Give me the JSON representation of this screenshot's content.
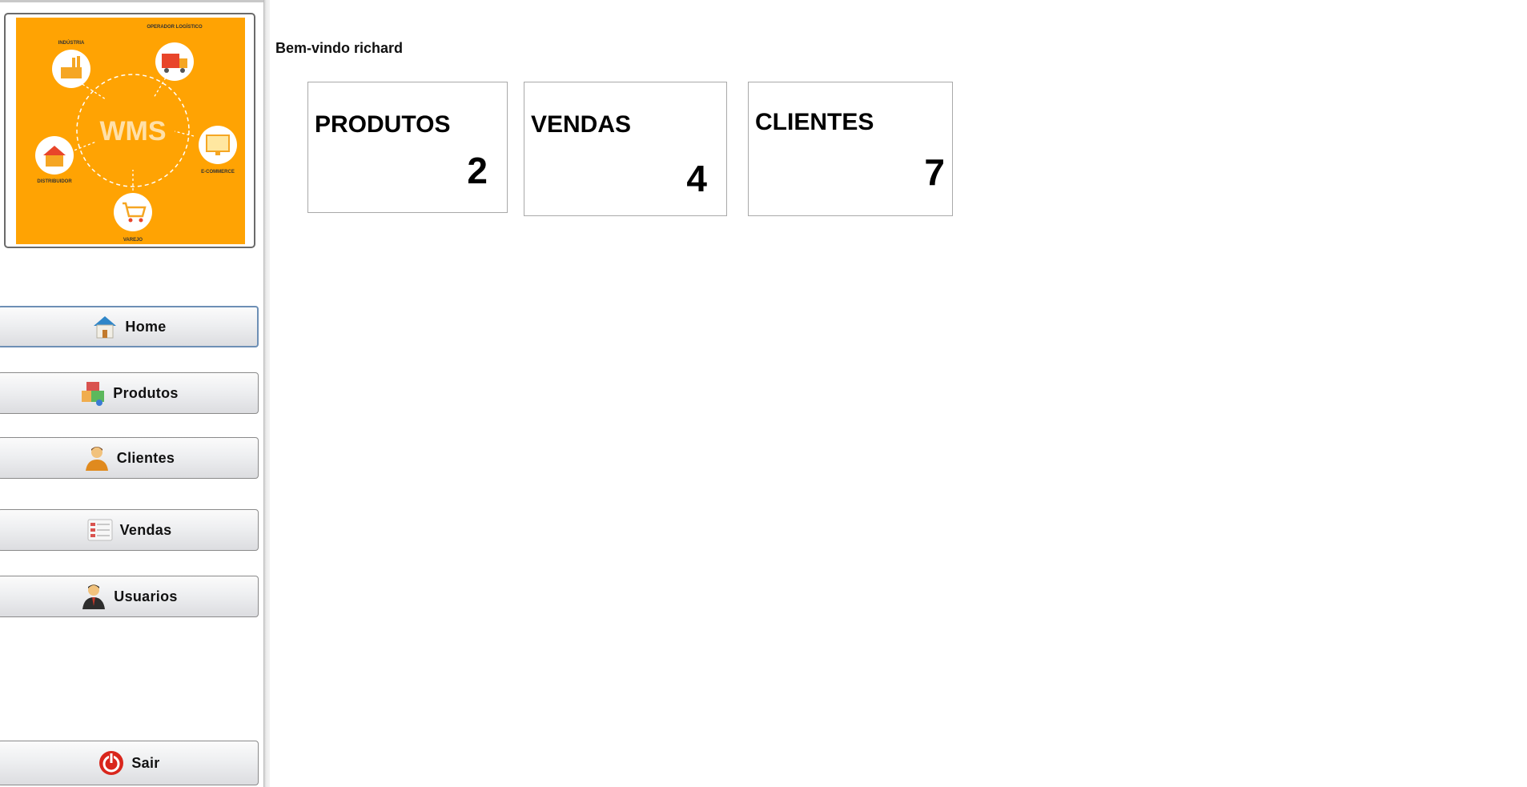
{
  "logo": {
    "center_text": "WMS",
    "nodes": [
      "INDÚSTRIA",
      "OPERADOR LOGÍSTICO",
      "E-COMMERCE",
      "VAREJO",
      "DISTRIBUIDOR"
    ],
    "accent": "#ffa303"
  },
  "sidebar": {
    "items": [
      {
        "label": "Home",
        "icon": "home-icon"
      },
      {
        "label": "Produtos",
        "icon": "boxes-icon"
      },
      {
        "label": "Clientes",
        "icon": "client-icon"
      },
      {
        "label": "Vendas",
        "icon": "list-icon"
      },
      {
        "label": "Usuarios",
        "icon": "user-icon"
      }
    ],
    "exit": {
      "label": "Sair",
      "icon": "power-icon"
    }
  },
  "main": {
    "welcome": "Bem-vindo richard",
    "cards": [
      {
        "title": "PRODUTOS",
        "value": "2"
      },
      {
        "title": "VENDAS",
        "value": "4"
      },
      {
        "title": "CLIENTES",
        "value": "7"
      }
    ]
  }
}
